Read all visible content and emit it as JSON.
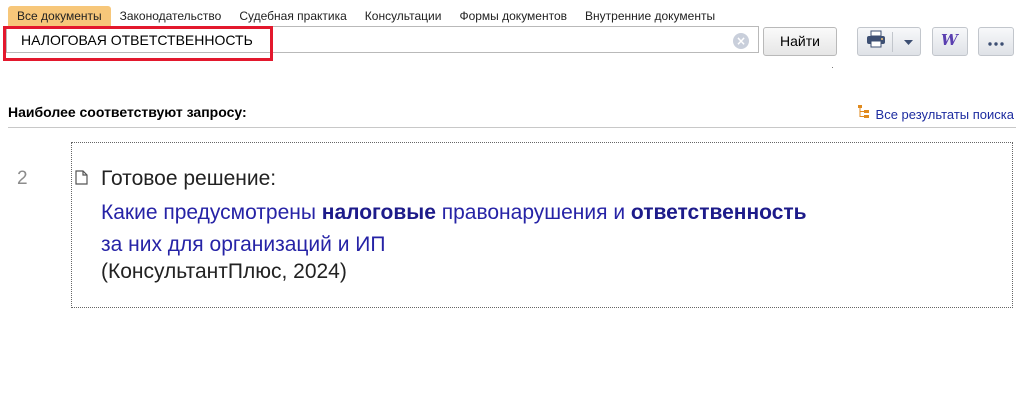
{
  "tabs": [
    {
      "label": "Все документы",
      "active": true
    },
    {
      "label": "Законодательство",
      "active": false
    },
    {
      "label": "Судебная практика",
      "active": false
    },
    {
      "label": "Консультации",
      "active": false
    },
    {
      "label": "Формы документов",
      "active": false
    },
    {
      "label": "Внутренние документы",
      "active": false
    }
  ],
  "search": {
    "value": "НАЛОГОВАЯ ОТВЕТСТВЕННОСТЬ",
    "find_label": "Найти",
    "clear_icon": "clear-circle-icon"
  },
  "toolbar": {
    "print_icon": "printer-icon",
    "dropdown_icon": "chevron-down-icon",
    "word_icon": "word-export-icon",
    "more_icon": "more-dots-icon"
  },
  "results_header": {
    "title": "Наиболее соответствуют запросу:",
    "all_results_label": "Все результаты поиска",
    "all_results_icon": "tree-list-icon"
  },
  "results": [
    {
      "number": "2",
      "type": "Готовое решение:",
      "title_parts": [
        {
          "text": "Какие предусмотрены ",
          "bold": false
        },
        {
          "text": "налоговые",
          "bold": true
        },
        {
          "text": " правонарушения и ",
          "bold": false
        },
        {
          "text": "ответственность",
          "bold": true
        },
        {
          "text": " за них для организаций и ИП",
          "bold": false
        }
      ],
      "source": "(КонсультантПлюс, 2024)",
      "icon": "document-icon"
    }
  ],
  "colors": {
    "active_tab": "#f7c77a",
    "highlight": "#e3182d",
    "link": "#2623a6"
  }
}
